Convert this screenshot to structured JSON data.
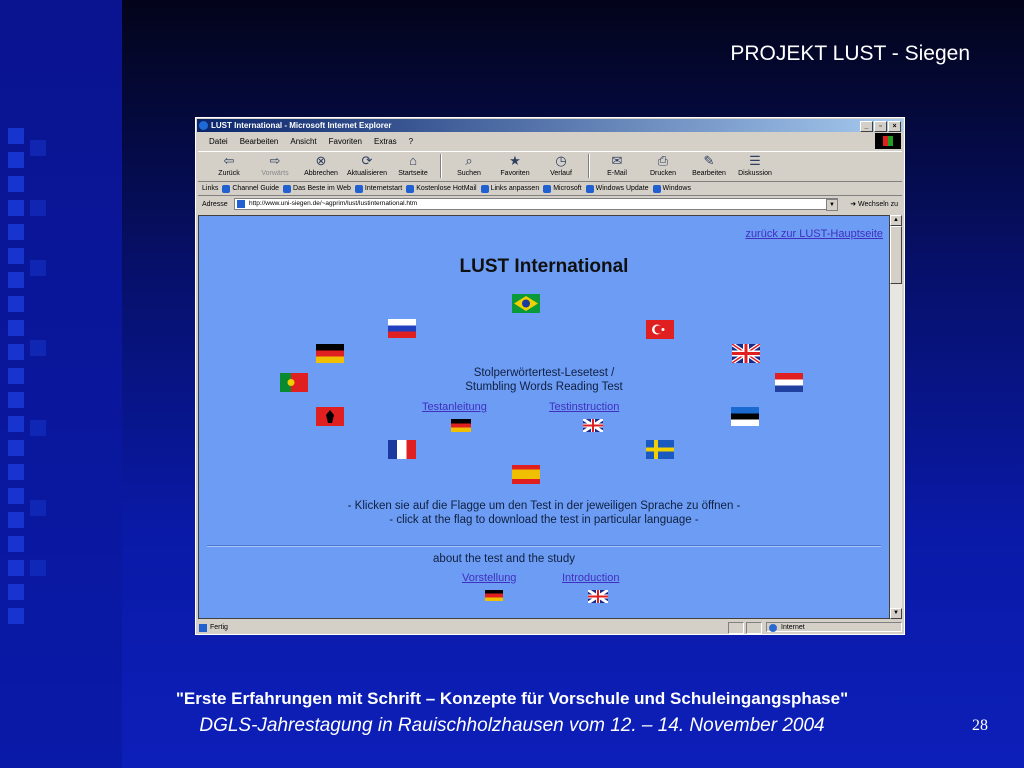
{
  "slide": {
    "title": "PROJEKT LUST - Siegen",
    "footer_line1": "\"Erste Erfahrungen mit Schrift – Konzepte für Vorschule und  Schuleingangsphase\"",
    "footer_line2": "DGLS-Jahrestagung in Rauischholzhausen vom 12. – 14. November 2004",
    "page_number": "28"
  },
  "browser": {
    "window_title": "LUST International - Microsoft Internet Explorer",
    "menu": [
      "Datei",
      "Bearbeiten",
      "Ansicht",
      "Favoriten",
      "Extras",
      "?"
    ],
    "toolbar": [
      {
        "label": "Zurück",
        "icon": "back-arrow-icon",
        "glyph": "⇦"
      },
      {
        "label": "Vorwärts",
        "icon": "forward-arrow-icon",
        "glyph": "⇨"
      },
      {
        "label": "Abbrechen",
        "icon": "stop-icon",
        "glyph": "⊗"
      },
      {
        "label": "Aktualisieren",
        "icon": "refresh-icon",
        "glyph": "⟳"
      },
      {
        "label": "Startseite",
        "icon": "home-icon",
        "glyph": "⌂"
      },
      {
        "label": "Suchen",
        "icon": "search-icon",
        "glyph": "⌕"
      },
      {
        "label": "Favoriten",
        "icon": "favorites-icon",
        "glyph": "★"
      },
      {
        "label": "Verlauf",
        "icon": "history-icon",
        "glyph": "◷"
      },
      {
        "label": "E-Mail",
        "icon": "mail-icon",
        "glyph": "✉"
      },
      {
        "label": "Drucken",
        "icon": "print-icon",
        "glyph": "⎙"
      },
      {
        "label": "Bearbeiten",
        "icon": "edit-icon",
        "glyph": "✎"
      },
      {
        "label": "Diskussion",
        "icon": "discussion-icon",
        "glyph": "☰"
      }
    ],
    "links_label": "Links",
    "links": [
      "Channel Guide",
      "Das Beste im Web",
      "Internetstart",
      "Kostenlose HotMail",
      "Links anpassen",
      "Microsoft",
      "Windows Update",
      "Windows"
    ],
    "address_label": "Adresse",
    "address_value": "http://www.uni-siegen.de/~agprim/lust/lustinternational.htm",
    "go_label": "Wechseln zu",
    "status_text": "Fertig",
    "zone_text": "Internet"
  },
  "page": {
    "back_link": "zurück zur LUST-Hauptseite",
    "title": "LUST International",
    "test_title_de": "Stolperwörtertest-Lesetest /",
    "test_title_en": "Stumbling Words Reading Test",
    "link_testanleitung": "Testanleitung",
    "link_testinstruction": "Testinstruction",
    "instruction_de": "- Klicken sie auf die Flagge um den Test in der jeweiligen Sprache zu öffnen -",
    "instruction_en": "- click at the flag to download the test in particular language -",
    "about_text": "about the test and the study",
    "link_vorstellung": "Vorstellung",
    "link_introduction": "Introduction"
  }
}
